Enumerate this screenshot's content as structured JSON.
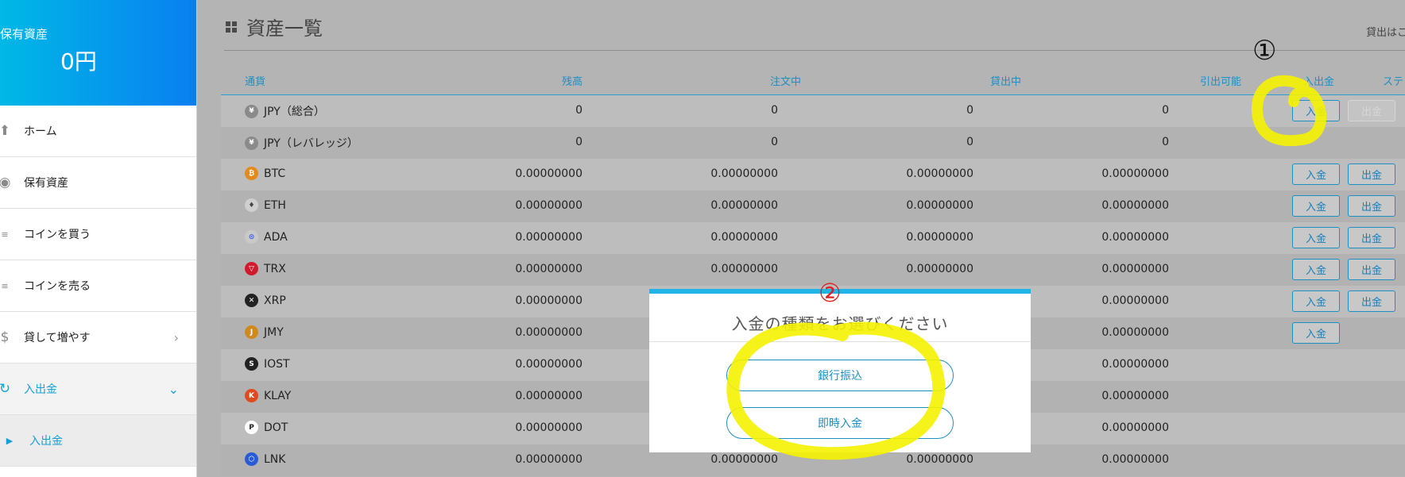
{
  "sidebar": {
    "assets_label": "保有資産",
    "assets_value": "0円",
    "items": [
      {
        "label": "ホーム",
        "icon": "home-icon"
      },
      {
        "label": "保有資産",
        "icon": "coins-icon"
      },
      {
        "label": "コインを買う",
        "icon": "coin-buy-icon"
      },
      {
        "label": "コインを売る",
        "icon": "coin-sell-icon"
      },
      {
        "label": "貸して増やす",
        "icon": "money-bag-icon"
      },
      {
        "label": "入出金",
        "icon": "transfer-icon"
      },
      {
        "label": "入出金",
        "icon": "caret-right-icon"
      }
    ]
  },
  "main": {
    "title": "資産一覧",
    "right_note": "貸出はこ",
    "columns": {
      "currency": "通貨",
      "balance": "残高",
      "in_order": "注文中",
      "lending": "貸出中",
      "withdrawable": "引出可能",
      "deposit_withdraw": "入出金",
      "status": "ステ"
    },
    "deposit_label": "入金",
    "withdraw_label": "出金",
    "rows": [
      {
        "coin": "JPY（総合）",
        "icon_glyph": "¥",
        "balance": "0",
        "in_order": "0",
        "lending": "0",
        "withdrawable": "0"
      },
      {
        "coin": "JPY（レバレッジ）",
        "icon_glyph": "¥",
        "balance": "0",
        "in_order": "0",
        "lending": "0",
        "withdrawable": "0"
      },
      {
        "coin": "BTC",
        "icon_glyph": "₿",
        "balance": "0.00000000",
        "in_order": "0.00000000",
        "lending": "0.00000000",
        "withdrawable": "0.00000000"
      },
      {
        "coin": "ETH",
        "icon_glyph": "♦",
        "balance": "0.00000000",
        "in_order": "0.00000000",
        "lending": "0.00000000",
        "withdrawable": "0.00000000"
      },
      {
        "coin": "ADA",
        "icon_glyph": "⊙",
        "balance": "0.00000000",
        "in_order": "0.00000000",
        "lending": "0.00000000",
        "withdrawable": "0.00000000"
      },
      {
        "coin": "TRX",
        "icon_glyph": "▽",
        "balance": "0.00000000",
        "in_order": "0.00000000",
        "lending": "0.00000000",
        "withdrawable": "0.00000000"
      },
      {
        "coin": "XRP",
        "icon_glyph": "✕",
        "balance": "0.00000000",
        "in_order": "",
        "lending": "",
        "withdrawable": "0.00000000"
      },
      {
        "coin": "JMY",
        "icon_glyph": "J",
        "balance": "0.00000000",
        "in_order": "",
        "lending": "",
        "withdrawable": "0.00000000"
      },
      {
        "coin": "IOST",
        "icon_glyph": "S",
        "balance": "0.00000000",
        "in_order": "",
        "lending": "",
        "withdrawable": "0.00000000"
      },
      {
        "coin": "KLAY",
        "icon_glyph": "K",
        "balance": "0.00000000",
        "in_order": "",
        "lending": "",
        "withdrawable": "0.00000000"
      },
      {
        "coin": "DOT",
        "icon_glyph": "P",
        "balance": "0.00000000",
        "in_order": "",
        "lending": "",
        "withdrawable": "0.00000000"
      },
      {
        "coin": "LNK",
        "icon_glyph": "⬡",
        "balance": "0.00000000",
        "in_order": "0.00000000",
        "lending": "0.00000000",
        "withdrawable": "0.00000000"
      }
    ]
  },
  "modal": {
    "title": "入金の種類をお選びください",
    "option_bank": "銀行振込",
    "option_instant": "即時入金"
  },
  "annotations": {
    "step1": "①",
    "step2": "②"
  },
  "colors": {
    "accent": "#1c8fc4",
    "header_gradient_start": "#00b8e6",
    "header_gradient_end": "#0a7ff0",
    "highlight": "#f4f200",
    "step2_red": "#e02020"
  }
}
